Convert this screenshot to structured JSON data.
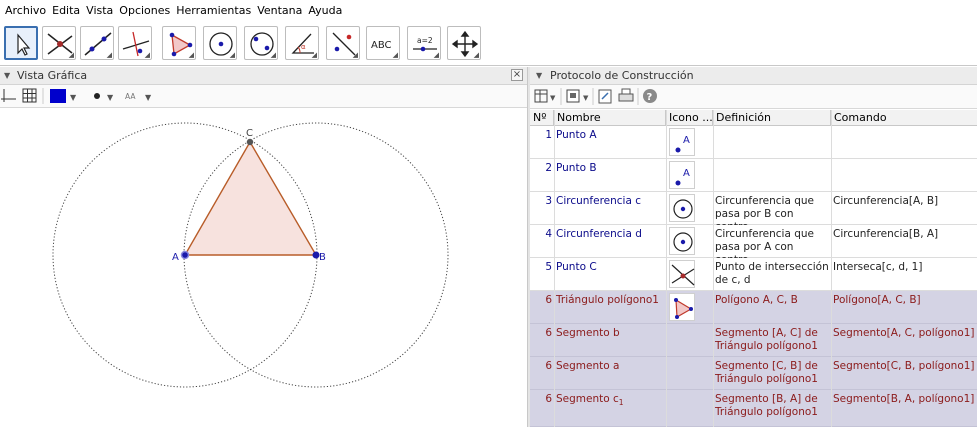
{
  "menu": [
    "Archivo",
    "Edita",
    "Vista",
    "Opciones",
    "Herramientas",
    "Ventana",
    "Ayuda"
  ],
  "toolbar": {
    "tools": [
      {
        "name": "move-tool-icon",
        "selected": true
      },
      {
        "name": "intersect-point-tool-icon"
      },
      {
        "name": "line-tool-icon"
      },
      {
        "name": "perpendicular-tool-icon"
      },
      {
        "name": "polygon-tool-icon"
      },
      {
        "name": "circle-center-point-tool-icon"
      },
      {
        "name": "circle-three-points-tool-icon"
      },
      {
        "name": "angle-tool-icon"
      },
      {
        "name": "reflect-tool-icon"
      },
      {
        "name": "text-tool-icon",
        "label": "ABC"
      },
      {
        "name": "slider-tool-icon",
        "label": "a=2"
      },
      {
        "name": "move-view-tool-icon"
      }
    ]
  },
  "graphics_view": {
    "title": "Vista Gráfica",
    "close": "×",
    "font_size_label": "AA",
    "color": "#0000cc",
    "points": {
      "A": "A",
      "B": "B",
      "C": "C"
    }
  },
  "construction_protocol": {
    "title": "Protocolo de Construcción",
    "columns": [
      "Nº",
      "Nombre",
      "Icono ...",
      "Definición",
      "Comando"
    ],
    "rows": [
      {
        "num": "1",
        "name": "Punto A",
        "icon": "point-icon",
        "definition": "",
        "command": "",
        "group": false
      },
      {
        "num": "2",
        "name": "Punto B",
        "icon": "point-icon",
        "definition": "",
        "command": "",
        "group": false
      },
      {
        "num": "3",
        "name": "Circunferencia c",
        "icon": "circle-center-point-icon",
        "definition": "Circunferencia que pasa por B con centro",
        "command": "Circunferencia[A, B]",
        "group": false
      },
      {
        "num": "4",
        "name": "Circunferencia d",
        "icon": "circle-center-point-icon",
        "definition": "Circunferencia que pasa por A con centro",
        "command": "Circunferencia[B, A]",
        "group": false
      },
      {
        "num": "5",
        "name": "Punto C",
        "icon": "intersect-icon",
        "definition": "Punto de intersección de c, d",
        "command": "Interseca[c, d, 1]",
        "group": false
      },
      {
        "num": "6",
        "name": "Triángulo polígono1",
        "icon": "polygon-icon",
        "definition": "Polígono A, C, B",
        "command": "Polígono[A, C, B]",
        "group": true
      },
      {
        "num": "6",
        "name": "Segmento b",
        "icon": "",
        "definition": "Segmento [A, C] de Triángulo polígono1",
        "command": "Segmento[A, C, polígono1]",
        "group": true
      },
      {
        "num": "6",
        "name": "Segmento a",
        "icon": "",
        "definition": "Segmento [C, B] de Triángulo polígono1",
        "command": "Segmento[C, B, polígono1]",
        "group": true
      },
      {
        "num": "6",
        "name": "Segmento c",
        "name_sub": "1",
        "icon": "",
        "definition": "Segmento [B, A] de Triángulo polígono1",
        "command": "Segmento[B, A, polígono1]",
        "group": true
      }
    ]
  }
}
